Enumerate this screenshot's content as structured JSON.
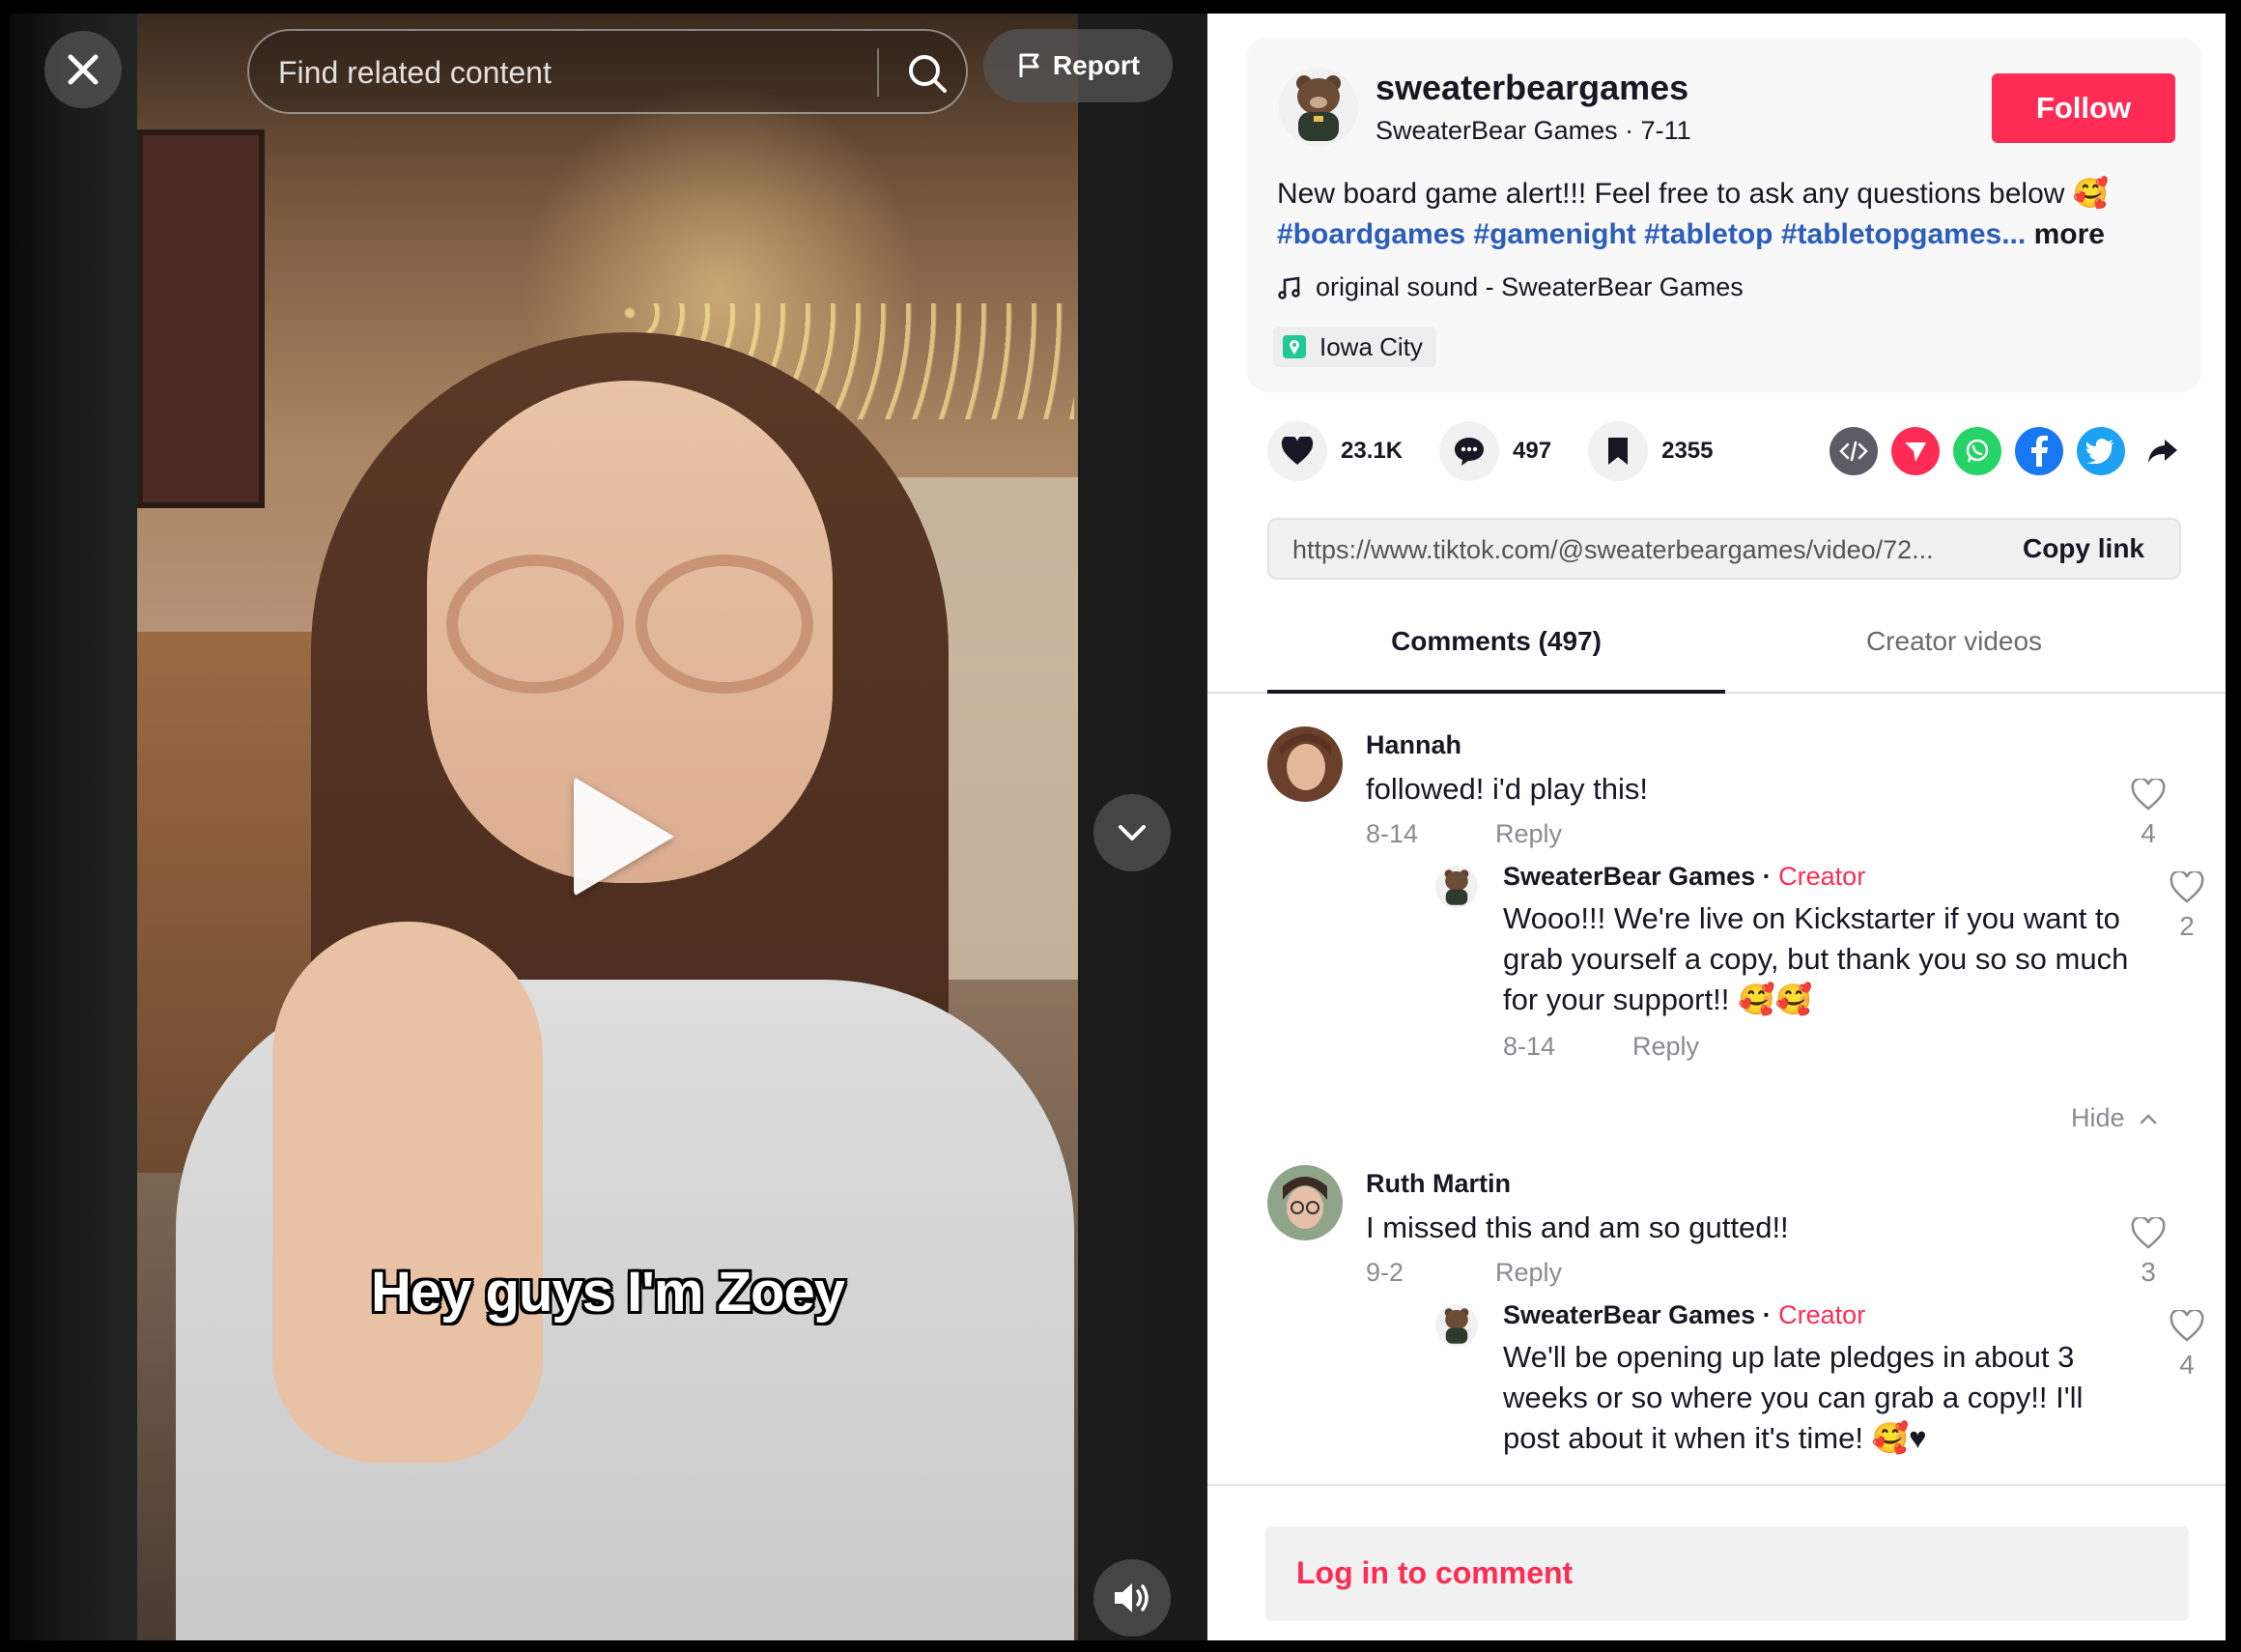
{
  "video": {
    "caption": "Hey guys I'm Zoey",
    "search": {
      "placeholder": "Find related content"
    },
    "report_label": "Report"
  },
  "post": {
    "username": "sweaterbeargames",
    "display_name": "SweaterBear Games",
    "date": "7-11",
    "follow_label": "Follow",
    "description": "New board game alert!!! Feel free to ask any questions below 🥰",
    "hashtags": [
      "#boardgames",
      "#gamenight",
      "#tabletop",
      "#tabletopgames..."
    ],
    "more_label": "more",
    "sound": "original sound - SweaterBear Games",
    "location": "Iowa City"
  },
  "stats": {
    "likes": "23.1K",
    "comments": "497",
    "saves": "2355"
  },
  "share_icons": [
    "embed-icon",
    "send-icon",
    "whatsapp-icon",
    "facebook-icon",
    "twitter-icon",
    "share-arrow-icon"
  ],
  "colors": {
    "accent": "#fe2c55",
    "hashtag": "#2b5db9",
    "whatsapp": "#25d366",
    "facebook": "#1877f2",
    "twitter": "#1da1f2",
    "embed": "#5a5d66"
  },
  "link": {
    "url": "https://www.tiktok.com/@sweaterbeargames/video/72...",
    "copy_label": "Copy link"
  },
  "tabs": [
    {
      "label": "Comments (497)",
      "active": true
    },
    {
      "label": "Creator videos",
      "active": false
    }
  ],
  "comments": [
    {
      "name": "Hannah",
      "text": "followed! i'd play this!",
      "date": "8-14",
      "reply_label": "Reply",
      "likes": "4",
      "reply": {
        "name": "SweaterBear Games",
        "sep": " · ",
        "tag": "Creator",
        "text": "Wooo!!! We're live on Kickstarter if you want to grab yourself a copy, but thank you so so much for your support!! 🥰🥰",
        "date": "8-14",
        "reply_label": "Reply",
        "likes": "2"
      },
      "hide_label": "Hide"
    },
    {
      "name": "Ruth Martin",
      "text": "I missed this and am so gutted!!",
      "date": "9-2",
      "reply_label": "Reply",
      "likes": "3",
      "reply": {
        "name": "SweaterBear Games",
        "sep": " · ",
        "tag": "Creator",
        "text": "We'll be opening up late pledges in about 3 weeks or so where you can grab a copy!! I'll post about it when it's time! 🥰♥",
        "likes": "4"
      }
    }
  ],
  "login_label": "Log in to comment"
}
